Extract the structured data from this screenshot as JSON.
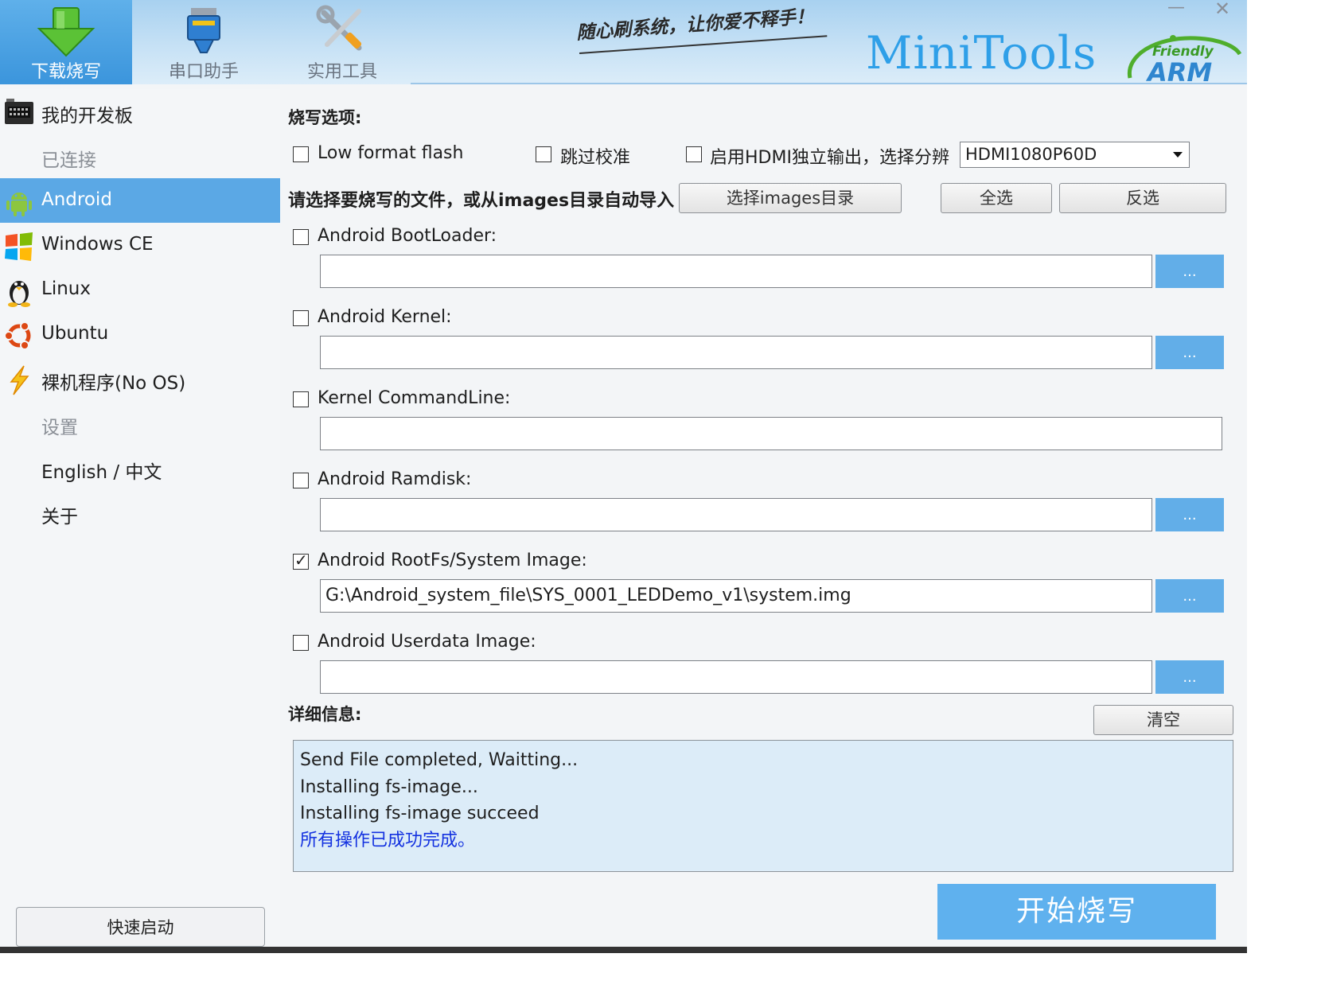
{
  "header": {
    "tabs": [
      {
        "label": "下载烧写",
        "icon": "download-arrow-icon"
      },
      {
        "label": "串口助手",
        "icon": "serial-port-icon"
      },
      {
        "label": "实用工具",
        "icon": "tools-icon"
      }
    ],
    "slogan": "随心刷系统，让你爱不释手！",
    "brand": "MiniTools",
    "logo_text": "Friendly ARM",
    "minimize": "—",
    "close": "✕"
  },
  "sidebar": {
    "items": [
      {
        "label": "我的开发板",
        "icon": "board-icon"
      },
      {
        "label": "已连接"
      },
      {
        "label": "Android",
        "icon": "android-icon"
      },
      {
        "label": "Windows CE",
        "icon": "windows-icon"
      },
      {
        "label": "Linux",
        "icon": "linux-tux-icon"
      },
      {
        "label": "Ubuntu",
        "icon": "ubuntu-icon"
      },
      {
        "label": "裸机程序(No OS)",
        "icon": "lightning-icon"
      },
      {
        "label": "设置"
      },
      {
        "label": "English / 中文"
      },
      {
        "label": "关于"
      }
    ],
    "quick_start": "快速启动"
  },
  "main": {
    "flash_options_title": "烧写选项:",
    "options": {
      "low_format": {
        "label": "Low format flash",
        "checked": false
      },
      "skip_calibration": {
        "label": "跳过校准",
        "checked": false
      },
      "hdmi_output": {
        "label": "启用HDMI独立输出，选择分辨",
        "checked": false
      },
      "hdmi_resolution": "HDMI1080P60D"
    },
    "file_prompt": "请选择要烧写的文件，或从images目录自动导入",
    "select_dir_button": "选择images目录",
    "select_all_button": "全选",
    "invert_button": "反选",
    "files": [
      {
        "label": "Android BootLoader:",
        "checked": false,
        "value": "",
        "browse": "..."
      },
      {
        "label": "Android Kernel:",
        "checked": false,
        "value": "",
        "browse": "..."
      },
      {
        "label": "Kernel CommandLine:",
        "checked": false,
        "value": ""
      },
      {
        "label": "Android Ramdisk:",
        "checked": false,
        "value": "",
        "browse": "..."
      },
      {
        "label": "Android RootFs/System Image:",
        "checked": true,
        "value": "G:\\Android_system_file\\SYS_0001_LEDDemo_v1\\system.img",
        "browse": "..."
      },
      {
        "label": "Android Userdata Image:",
        "checked": false,
        "value": "",
        "browse": "..."
      }
    ],
    "details_title": "详细信息:",
    "clear_button": "清空",
    "log": [
      "Send File completed, Waitting...",
      "Installing fs-image...",
      "Installing fs-image succeed",
      "所有操作已成功完成。"
    ],
    "start_button": "开始烧写"
  },
  "colors": {
    "accent": "#5ba8e5",
    "header_bg": "#c6e1f5",
    "browse_button": "#62aee8",
    "log_bg": "#dcecf8",
    "success_text": "#1432e0"
  }
}
